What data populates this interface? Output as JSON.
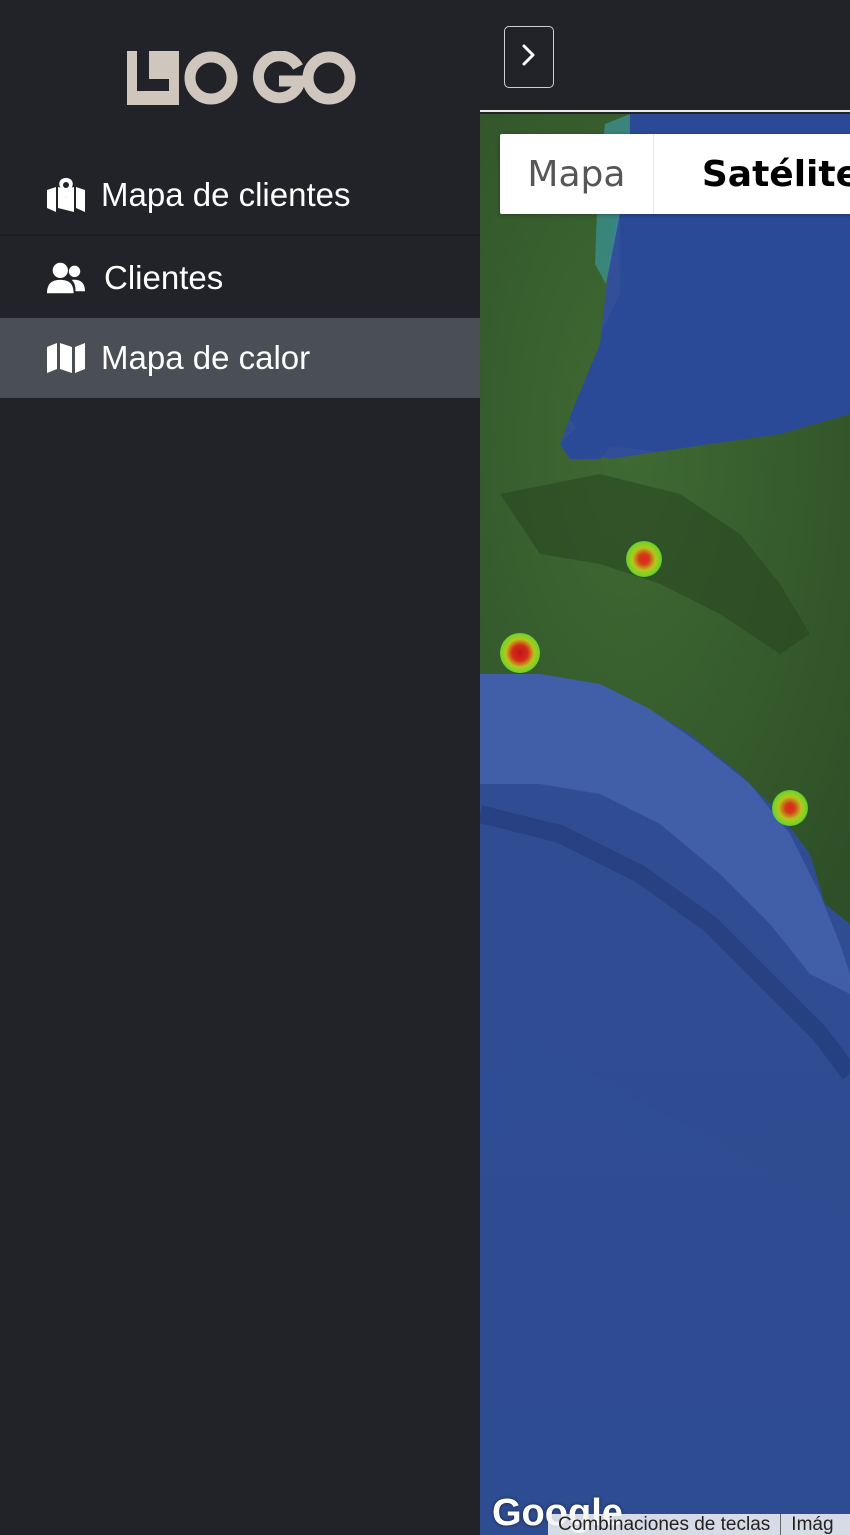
{
  "logo": {
    "text": "LOGO",
    "color": "#cfc6be"
  },
  "sidebar": {
    "items": [
      {
        "label": "Mapa de clientes",
        "icon": "map-marked-icon",
        "active": false
      },
      {
        "label": "Clientes",
        "icon": "users-icon",
        "active": false
      },
      {
        "label": "Mapa de calor",
        "icon": "map-icon",
        "active": true
      }
    ]
  },
  "header": {
    "toggle_icon": "chevron-right-icon"
  },
  "map": {
    "type_options": [
      {
        "label": "Mapa",
        "selected": false
      },
      {
        "label": "Satélite",
        "selected": true
      }
    ],
    "google_logo": "Google",
    "footer": {
      "shortcuts": "Combinaciones de teclas",
      "imagery": "Imág"
    }
  },
  "colors": {
    "sidebar_bg": "#212329",
    "active_item_bg": "#4a4e55",
    "text": "#ffffff"
  }
}
